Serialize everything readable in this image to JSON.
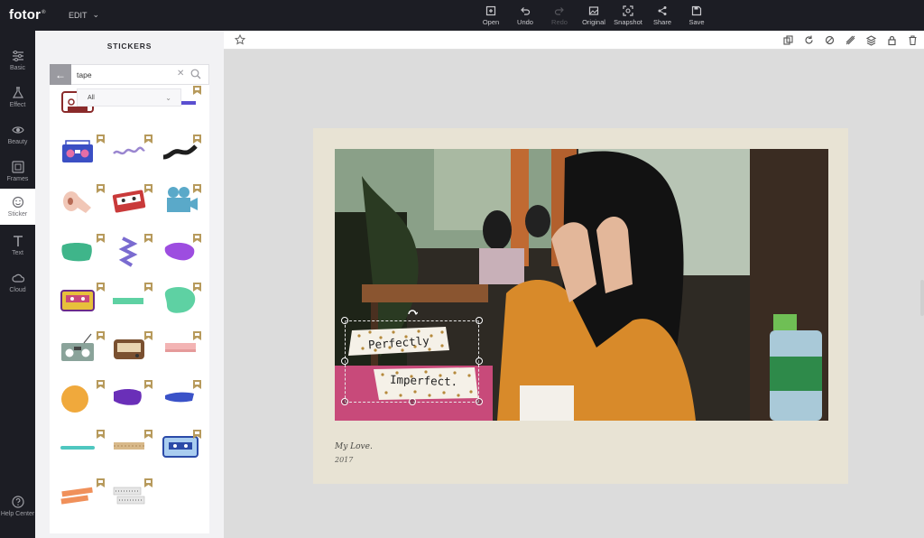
{
  "app": {
    "logo": "fotor",
    "logo_mark": "®",
    "menu": "EDIT"
  },
  "toolbar": {
    "items": [
      {
        "label": "Open",
        "icon": "open-icon",
        "enabled": true
      },
      {
        "label": "Undo",
        "icon": "undo-icon",
        "enabled": true
      },
      {
        "label": "Redo",
        "icon": "redo-icon",
        "enabled": false
      },
      {
        "label": "Original",
        "icon": "original-icon",
        "enabled": true
      },
      {
        "label": "Snapshot",
        "icon": "snapshot-icon",
        "enabled": true
      },
      {
        "label": "Share",
        "icon": "share-icon",
        "enabled": true
      },
      {
        "label": "Save",
        "icon": "save-icon",
        "enabled": true
      }
    ]
  },
  "rail": {
    "items": [
      {
        "label": "Basic",
        "icon": "sliders-icon"
      },
      {
        "label": "Effect",
        "icon": "flask-icon"
      },
      {
        "label": "Beauty",
        "icon": "eye-icon"
      },
      {
        "label": "Frames",
        "icon": "frame-icon"
      },
      {
        "label": "Sticker",
        "icon": "sticker-icon",
        "active": true
      },
      {
        "label": "Text",
        "icon": "text-icon"
      },
      {
        "label": "Cloud",
        "icon": "cloud-icon"
      }
    ],
    "help": "Help Center"
  },
  "panel": {
    "title": "STICKERS",
    "search_value": "tape",
    "filter_value": "All",
    "stickers": [
      "cassette-tape-red",
      "purple-tape-strip",
      "blue-purple-tape",
      "boombox-blue",
      "purple-squiggle",
      "black-ribbon",
      "tape-roll",
      "cassette-red",
      "projector-camera",
      "green-paint",
      "purple-zigzag",
      "purple-paint",
      "cassette-yellow",
      "green-strip",
      "green-blob",
      "radio-cassette",
      "vintage-radio",
      "pink-strip",
      "orange-circle",
      "purple-brush",
      "blue-brush",
      "teal-stroke",
      "burlap-tape",
      "blue-cassette",
      "orange-tape",
      "gray-dotted-tape"
    ]
  },
  "workspace": {
    "tools": [
      "copy-icon",
      "flip-icon",
      "brush-icon",
      "mirror-icon",
      "layers-icon",
      "lock-icon",
      "trash-icon"
    ]
  },
  "canvas": {
    "caption_line1": "My Love.",
    "caption_line2": "2017",
    "sticker_text1": "Perfectly",
    "sticker_text2": "Imperfect."
  },
  "colors": {
    "dark_bar": "#1c1d24",
    "accent_gold": "#b79a5c",
    "paper": "#e8e3d4"
  }
}
